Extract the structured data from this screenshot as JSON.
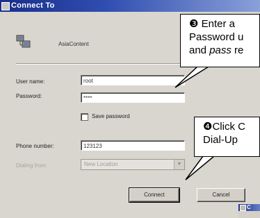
{
  "window": {
    "title": "Connect To"
  },
  "connection": {
    "name": "AsiaContent"
  },
  "form": {
    "username": {
      "label": "User name:",
      "value": "root"
    },
    "password": {
      "label": "Password:",
      "value": "****"
    },
    "save_password": {
      "label": "Save password",
      "checked": false
    },
    "phone": {
      "label": "Phone number:",
      "value": "123123"
    },
    "dialing_from": {
      "label": "Dialing from:",
      "value": "New Location"
    }
  },
  "buttons": {
    "connect": "Connect",
    "cancel": "Cancel"
  },
  "callouts": [
    {
      "number": "❸",
      "line1": "Enter a",
      "line2": "Password u",
      "line3_pre": "and ",
      "line3_em": "pass",
      "line3_post": " re"
    },
    {
      "number": "❹",
      "line1": "Click C",
      "line2": "Dial-Up"
    }
  ],
  "mini_dialog": {
    "title": "C"
  },
  "colors": {
    "titlebar_start": "#1a2e8a",
    "titlebar_end": "#8aa0d8",
    "callout_border": "#000000"
  }
}
